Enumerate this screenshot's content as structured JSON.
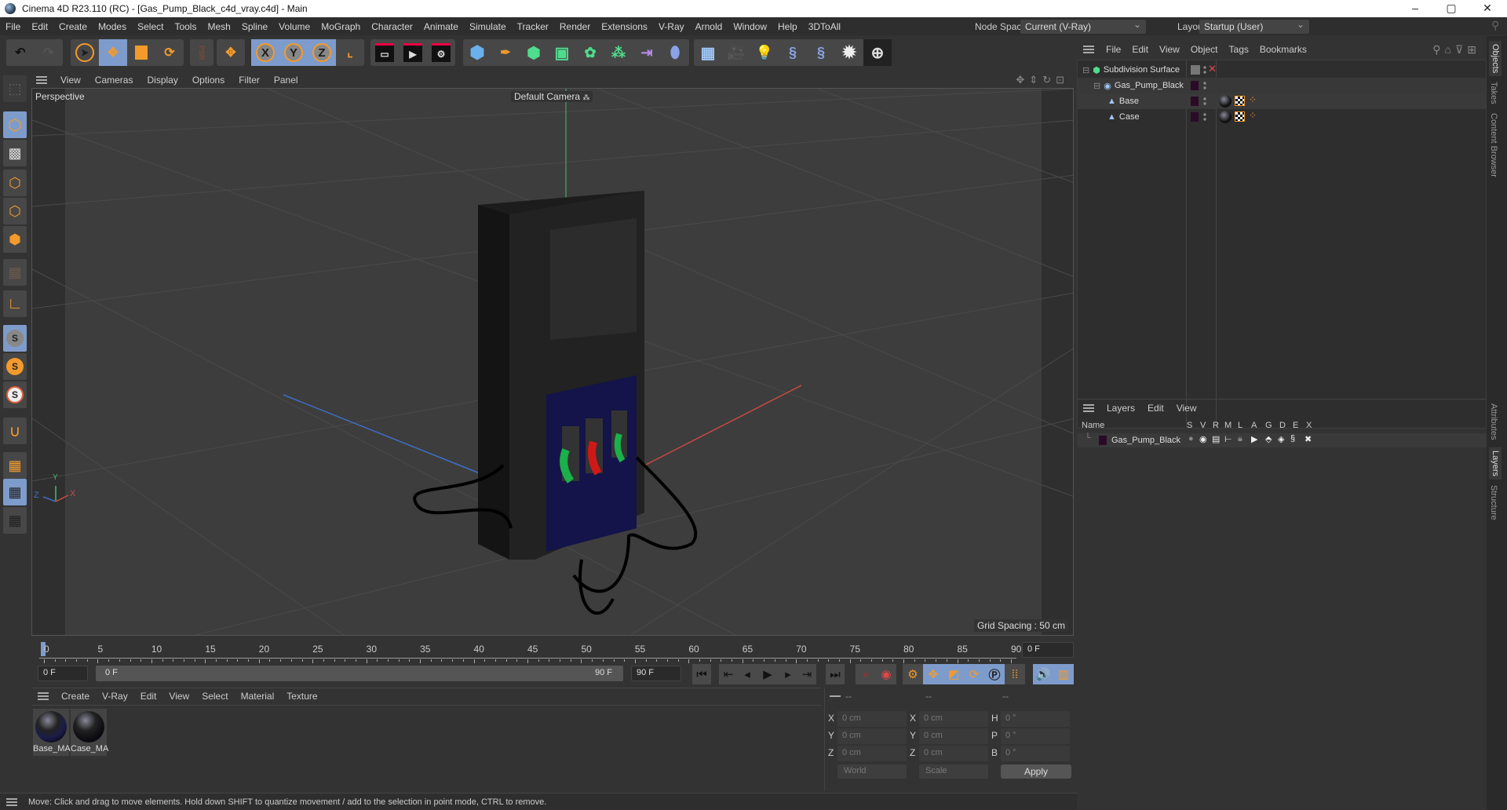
{
  "window": {
    "title": "Cinema 4D R23.110 (RC) - [Gas_Pump_Black_c4d_vray.c4d] - Main",
    "controls": {
      "minimize": "–",
      "maximize": "▢",
      "close": "✕"
    }
  },
  "menubar": {
    "items": [
      "File",
      "Edit",
      "Create",
      "Modes",
      "Select",
      "Tools",
      "Mesh",
      "Spline",
      "Volume",
      "MoGraph",
      "Character",
      "Animate",
      "Simulate",
      "Tracker",
      "Render",
      "Extensions",
      "V-Ray",
      "Arnold",
      "Window",
      "Help",
      "3DToAll"
    ],
    "node_space_label": "Node Space:",
    "node_space_value": "Current (V-Ray)",
    "layout_label": "Layout:",
    "layout_value": "Startup (User)"
  },
  "toolbar": {
    "axis_x": "X",
    "axis_y": "Y",
    "axis_z": "Z",
    "psr": "PSR"
  },
  "viewport": {
    "menu": [
      "View",
      "Cameras",
      "Display",
      "Options",
      "Filter",
      "Panel"
    ],
    "projection": "Perspective",
    "camera": "Default Camera",
    "grid_spacing": "Grid Spacing : 50 cm",
    "axis_labels": {
      "x": "X",
      "y": "Y",
      "z": "Z"
    },
    "accent_colors": {
      "x_axis": "#c84a45",
      "y_axis": "#3fbf6a",
      "z_axis": "#3f6fc4"
    }
  },
  "timeline": {
    "ticks": [
      "0",
      "5",
      "10",
      "15",
      "20",
      "25",
      "30",
      "35",
      "40",
      "45",
      "50",
      "55",
      "60",
      "65",
      "70",
      "75",
      "80",
      "85",
      "90"
    ],
    "current_frame": "0 F",
    "start_field": "0 F",
    "range_start": "0 F",
    "range_end": "90 F",
    "end_field": "90 F"
  },
  "materials": {
    "menu": [
      "Create",
      "V-Ray",
      "Edit",
      "View",
      "Select",
      "Material",
      "Texture"
    ],
    "items": [
      {
        "name": "Base_MA"
      },
      {
        "name": "Case_MA"
      }
    ]
  },
  "coordinates": {
    "headers": [
      "--",
      "--",
      "--"
    ],
    "pos": [
      {
        "axis": "X",
        "value": "0 cm"
      },
      {
        "axis": "Y",
        "value": "0 cm"
      },
      {
        "axis": "Z",
        "value": "0 cm"
      }
    ],
    "size": [
      {
        "axis": "X",
        "value": "0 cm"
      },
      {
        "axis": "Y",
        "value": "0 cm"
      },
      {
        "axis": "Z",
        "value": "0 cm"
      }
    ],
    "rot": [
      {
        "axis": "H",
        "value": "0 °"
      },
      {
        "axis": "P",
        "value": "0 °"
      },
      {
        "axis": "B",
        "value": "0 °"
      }
    ],
    "mode": "World",
    "type": "Scale",
    "apply": "Apply"
  },
  "objects": {
    "menu": [
      "File",
      "Edit",
      "View",
      "Object",
      "Tags",
      "Bookmarks"
    ],
    "rows": [
      {
        "name": "Subdivision Surface",
        "level": 0
      },
      {
        "name": "Gas_Pump_Black",
        "level": 1
      },
      {
        "name": "Base",
        "level": 2
      },
      {
        "name": "Case",
        "level": 2
      }
    ]
  },
  "layers": {
    "menu": [
      "Layers",
      "Edit",
      "View"
    ],
    "columns": [
      "Name",
      "S",
      "V",
      "R",
      "M",
      "L",
      "A",
      "G",
      "D",
      "E",
      "X"
    ],
    "rows": [
      {
        "name": "Gas_Pump_Black",
        "color": "#2b0a27"
      }
    ]
  },
  "side_tabs": {
    "top": [
      "Objects",
      "Takes",
      "Content Browser"
    ],
    "bottom": [
      "Attributes",
      "Layers",
      "Structure"
    ]
  },
  "status": "Move: Click and drag to move elements. Hold down SHIFT to quantize movement / add to the selection in point mode, CTRL to remove."
}
